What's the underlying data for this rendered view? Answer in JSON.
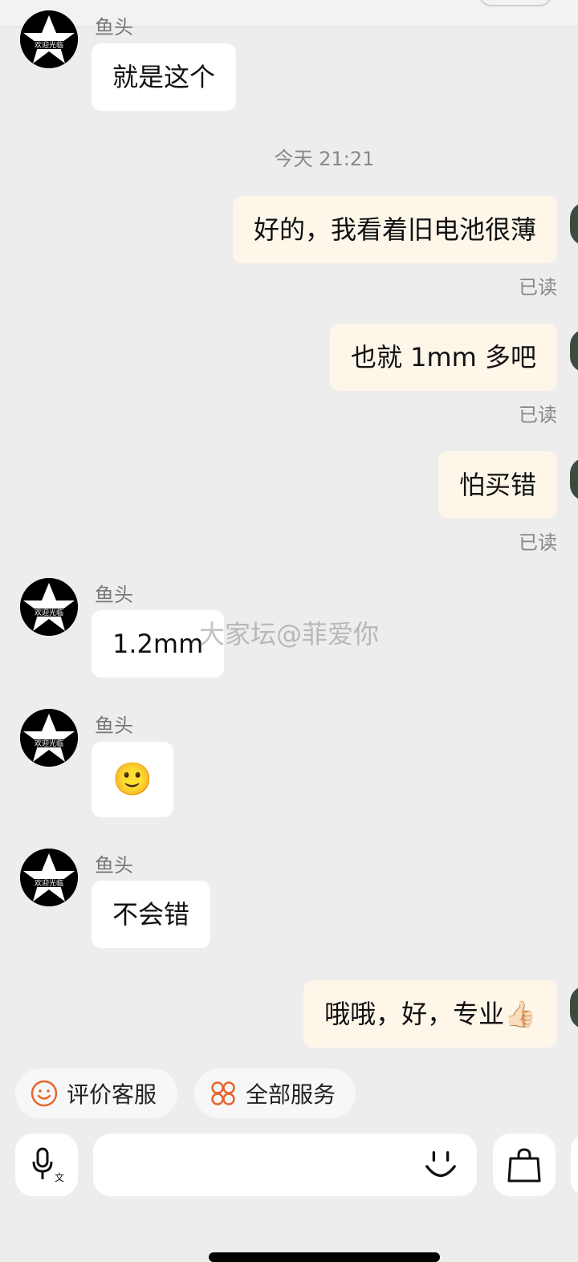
{
  "header": {
    "title": ""
  },
  "timestamp": "今天 21:21",
  "watermark": "大家坛@菲爱你",
  "messages": [
    {
      "side": "left",
      "sender": "鱼头",
      "text": "就是这个"
    },
    {
      "side": "right",
      "text": "好的，我看着旧电池很薄",
      "status": "已读"
    },
    {
      "side": "right",
      "text": "也就 1mm 多吧",
      "status": "已读"
    },
    {
      "side": "right",
      "text": "怕买错",
      "status": "已读"
    },
    {
      "side": "left",
      "sender": "鱼头",
      "text": "1.2mm"
    },
    {
      "side": "left",
      "sender": "鱼头",
      "text": "🙂"
    },
    {
      "side": "left",
      "sender": "鱼头",
      "text": "不会错"
    },
    {
      "side": "right",
      "text": "哦哦，好，专业👍🏻"
    }
  ],
  "quick_actions": [
    {
      "label": "评价客服",
      "icon": "smile-icon"
    },
    {
      "label": "全部服务",
      "icon": "grid-services-icon"
    }
  ],
  "input": {
    "placeholder": ""
  },
  "colors": {
    "accent": "#e8652d",
    "right_bubble": "#fdf6e9",
    "background": "#ededed"
  }
}
